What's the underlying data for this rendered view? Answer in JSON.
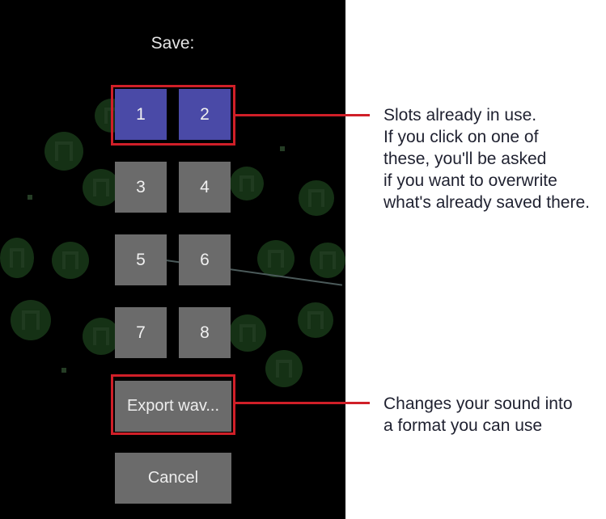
{
  "dialog": {
    "title": "Save:",
    "slots": [
      {
        "label": "1",
        "state": "used"
      },
      {
        "label": "2",
        "state": "used"
      },
      {
        "label": "3",
        "state": "empty"
      },
      {
        "label": "4",
        "state": "empty"
      },
      {
        "label": "5",
        "state": "empty"
      },
      {
        "label": "6",
        "state": "empty"
      },
      {
        "label": "7",
        "state": "empty"
      },
      {
        "label": "8",
        "state": "empty"
      }
    ],
    "export_label": "Export wav...",
    "cancel_label": "Cancel"
  },
  "annotations": {
    "slots_callout": "Slots already in use.\nIf you click on one of\nthese, you'll be asked\nif you want to overwrite\nwhat's already saved there.",
    "export_callout": "Changes your sound into\na format you can use"
  },
  "colors": {
    "used_slot": "#4a4aa7",
    "empty_slot": "#6b6b6b",
    "highlight": "#d01f28",
    "phone_background": "#000000",
    "background_icons": "#173417"
  },
  "icons": {
    "background": [
      "drum-icon",
      "hand-icon",
      "cymbal-icon",
      "guitar-icon",
      "speaker-icon"
    ]
  }
}
